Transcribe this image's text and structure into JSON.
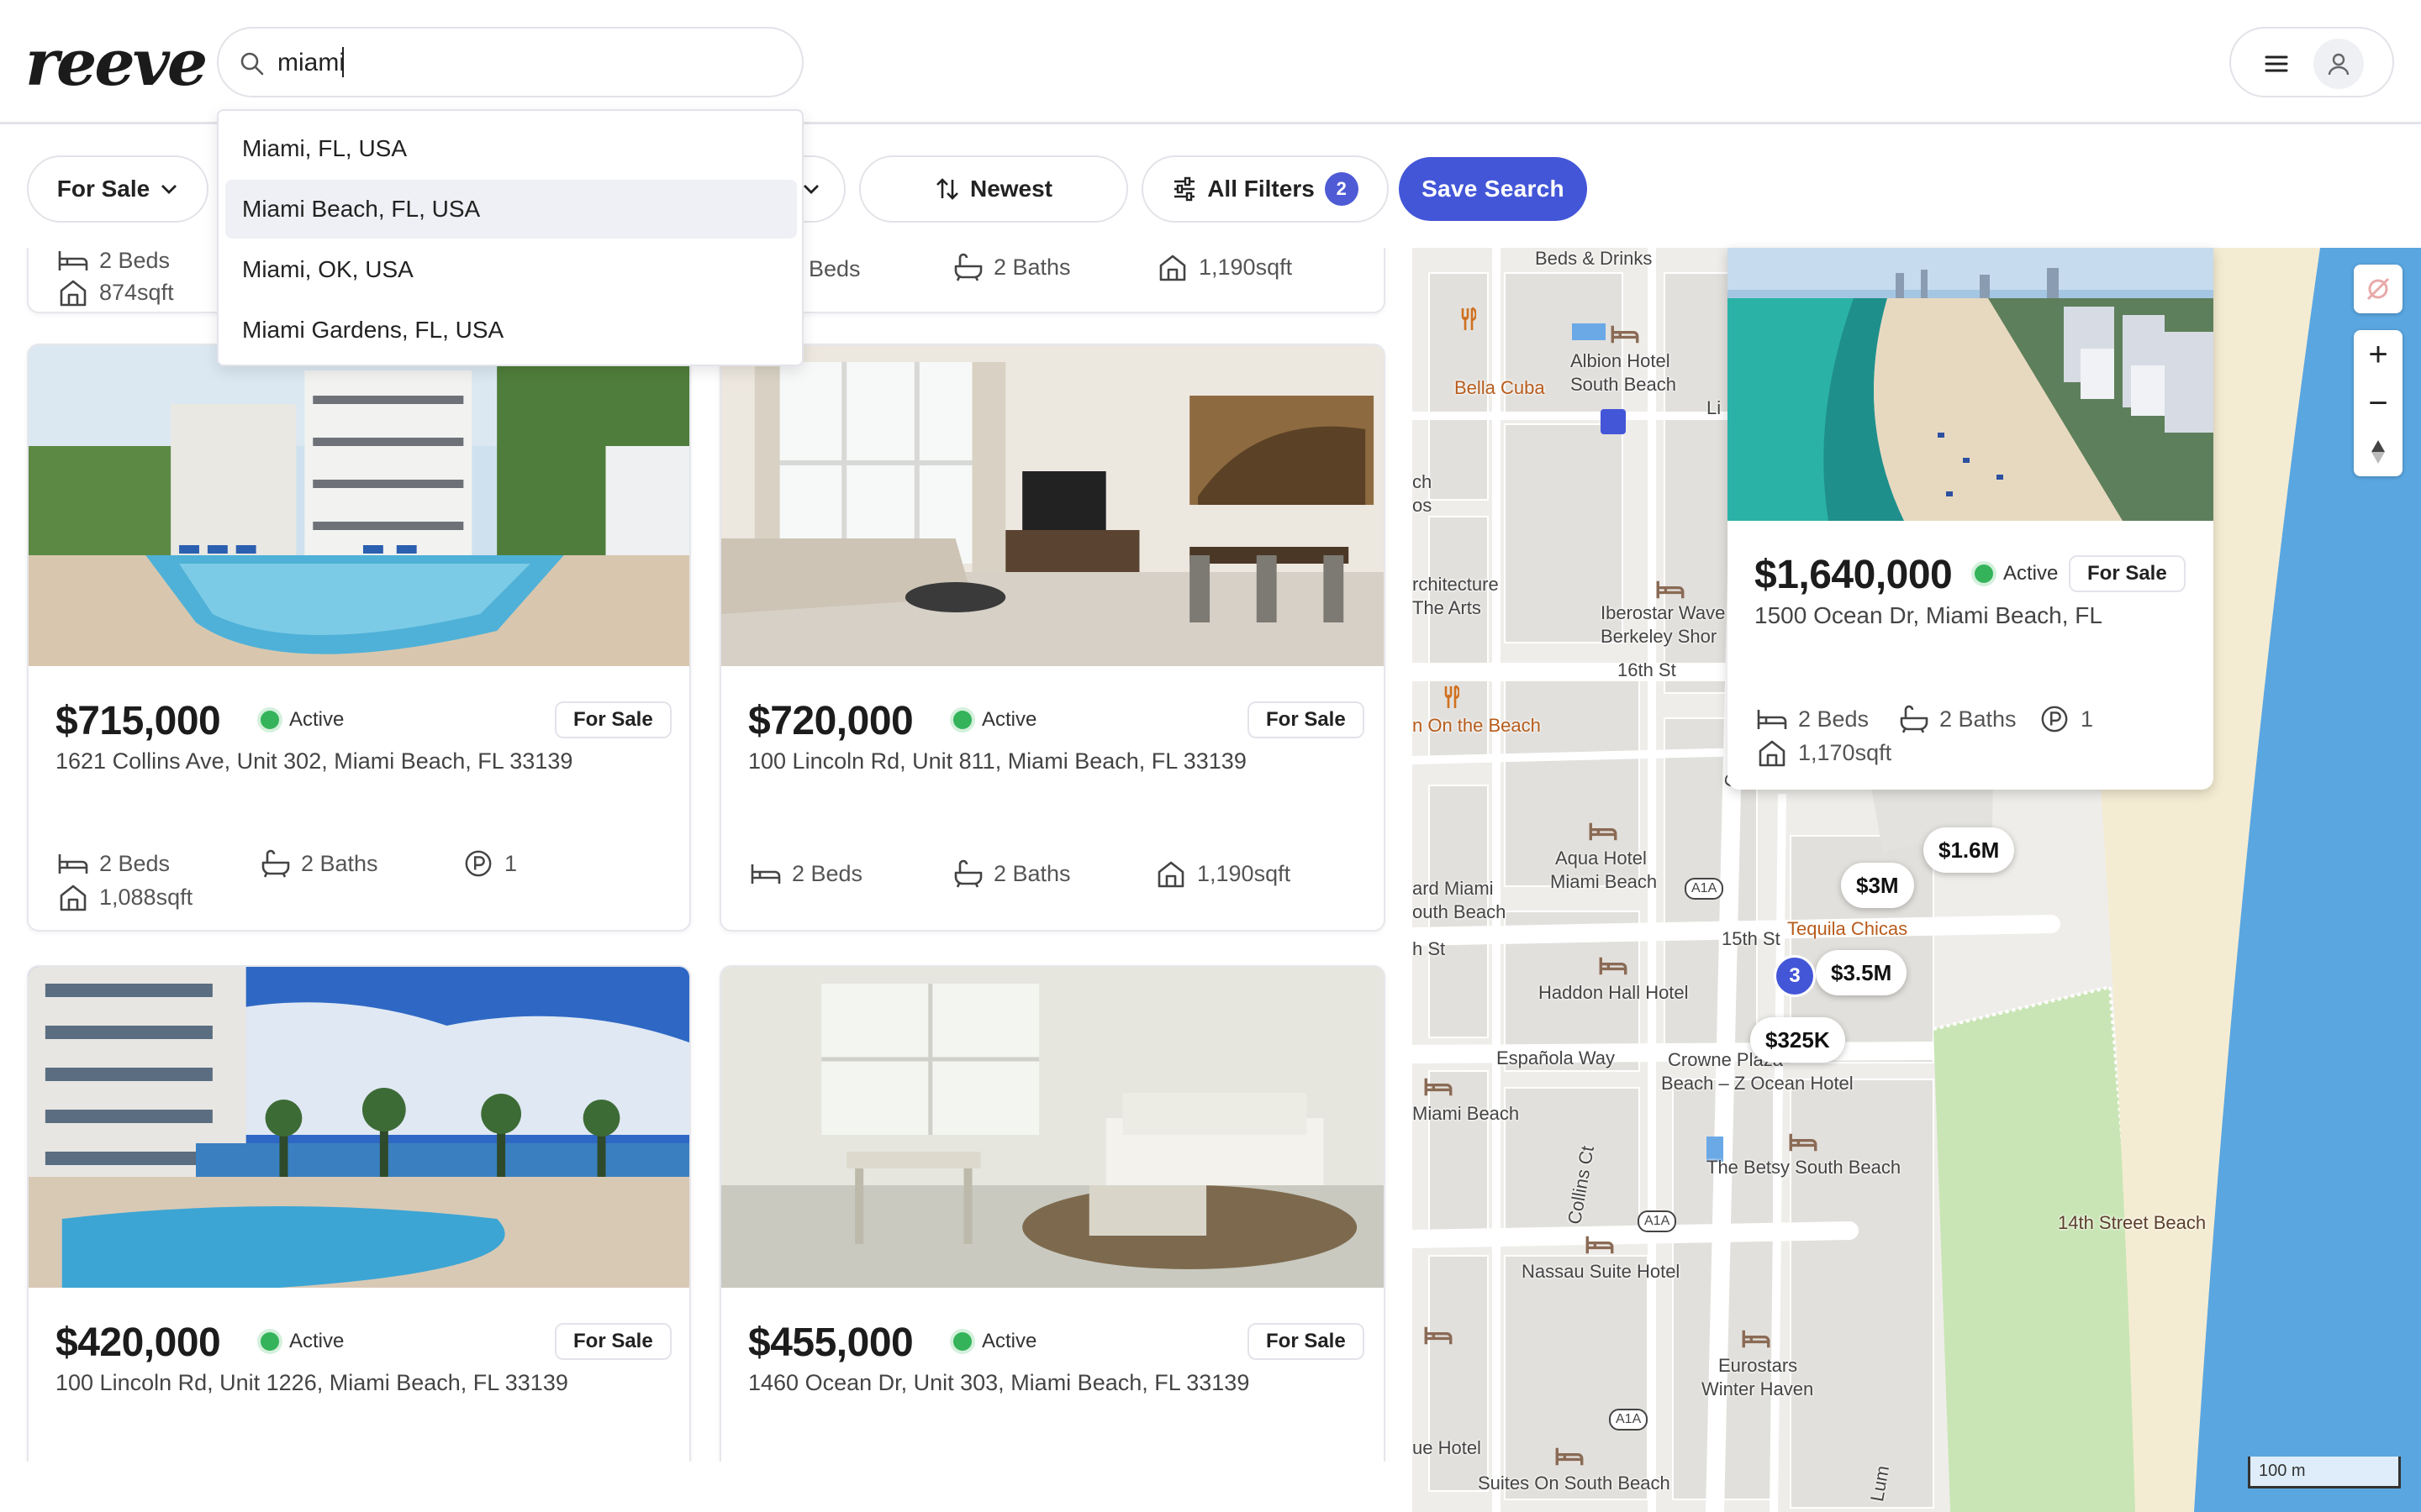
{
  "app": {
    "logo": "reeve"
  },
  "search": {
    "value": "miami",
    "placeholder": ""
  },
  "dropdown": {
    "items": [
      "Miami, FL, USA",
      "Miami Beach, FL, USA",
      "Miami, OK, USA",
      "Miami Gardens, FL, USA"
    ],
    "highlighted_index": 1
  },
  "filters": {
    "listing_type": "For Sale",
    "sort": "Newest",
    "all_filters": "All Filters",
    "all_filters_count": "2",
    "save_search": "Save  Search"
  },
  "top_partial": {
    "left": {
      "beds": "2 Beds",
      "sqft": "874sqft"
    },
    "right": {
      "beds": "Beds",
      "baths": "2 Baths",
      "sqft": "1,190sqft"
    }
  },
  "listings": [
    {
      "price": "$715,000",
      "status": "Active",
      "tag": "For Sale",
      "address": "1621 Collins Ave, Unit 302, Miami Beach, FL 33139",
      "beds": "2 Beds",
      "baths": "2 Baths",
      "parking": "1",
      "sqft": "1,088sqft"
    },
    {
      "price": "$720,000",
      "status": "Active",
      "tag": "For Sale",
      "address": "100 Lincoln Rd, Unit 811, Miami Beach, FL 33139",
      "beds": "2 Beds",
      "baths": "2 Baths",
      "sqft": "1,190sqft"
    },
    {
      "price": "$420,000",
      "status": "Active",
      "tag": "For Sale",
      "address": "100 Lincoln Rd, Unit 1226, Miami Beach, FL 33139"
    },
    {
      "price": "$455,000",
      "status": "Active",
      "tag": "For Sale",
      "address": "1460 Ocean Dr, Unit 303, Miami Beach, FL 33139"
    }
  ],
  "map": {
    "labels": {
      "beds_drinks": "Beds & Drinks",
      "albion": "Albion Hotel",
      "albion2": "South Beach",
      "bella_cuba": "Bella Cuba",
      "li": "Li",
      "ch": "ch",
      "os": "os",
      "architecture": "rchitecture",
      "the_arts": "The Arts",
      "iberostar": "Iberostar Wave",
      "berkeley": "Berkeley Shor",
      "st16": "16th St",
      "on_the_beach": "n On the Beach",
      "collins_ave": "Collins Ave",
      "aqua": "Aqua Hotel",
      "aqua2": "Miami Beach",
      "ard_miami": "ard Miami",
      "outh_beach": "outh Beach",
      "h_st": "h St",
      "st15": "15th St",
      "tequila": "Tequila Chicas",
      "haddon": "Haddon Hall Hotel",
      "espanola": "Española Way",
      "crowne": "Crowne Plaza",
      "crowne2": "Beach – Z Ocean Hotel",
      "miami_beach": "Miami Beach",
      "betsy": "The Betsy South Beach",
      "collins_ct": "Collins Ct",
      "nassau": "Nassau Suite Hotel",
      "fourteenth": "14th Street Beach",
      "eurostars": "Eurostars",
      "eurostars2": "Winter Haven",
      "ue_hotel": "ue Hotel",
      "suites": "Suites On South Beach",
      "lum": "Lum",
      "a1a": "A1A"
    },
    "pins": [
      "$1.6M",
      "$3M",
      "$3.5M",
      "$325K"
    ],
    "cluster": "3",
    "scale": "100 m"
  },
  "popup": {
    "price": "$1,640,000",
    "status": "Active",
    "tag": "For Sale",
    "address": "1500 Ocean Dr, Miami Beach, FL",
    "beds": "2 Beds",
    "baths": "2 Baths",
    "parking": "1",
    "sqft": "1,170sqft"
  },
  "colors": {
    "accent": "#4356d8",
    "active": "#35b35a",
    "water": "#5aa6e0",
    "park": "#c9e5b5",
    "sand": "#f4ecd2"
  }
}
